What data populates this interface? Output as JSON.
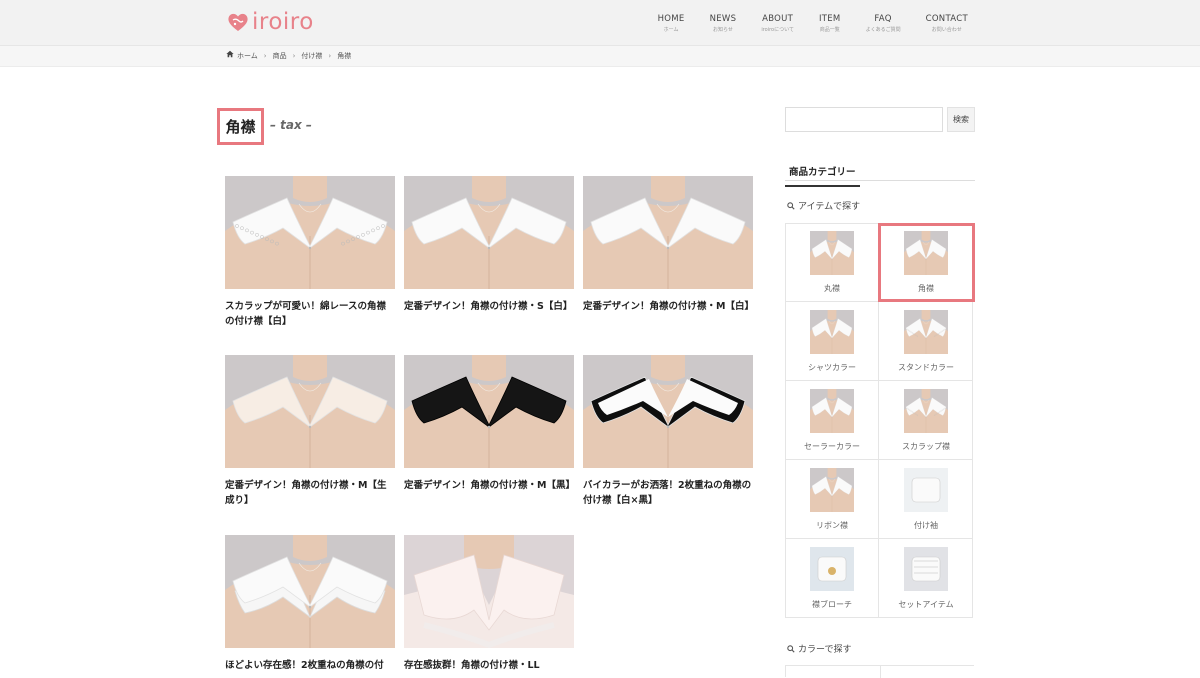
{
  "header": {
    "logo_text": "iroiro",
    "brand_color": "#e8828a",
    "nav": [
      {
        "label": "HOME",
        "sub": "ホーム"
      },
      {
        "label": "NEWS",
        "sub": "お知らせ"
      },
      {
        "label": "ABOUT",
        "sub": "iroiroについて"
      },
      {
        "label": "ITEM",
        "sub": "商品一覧"
      },
      {
        "label": "FAQ",
        "sub": "よくあるご質問"
      },
      {
        "label": "CONTACT",
        "sub": "お問い合わせ"
      }
    ]
  },
  "breadcrumb": {
    "items": [
      "ホーム",
      "商品",
      "付け襟",
      "角襟"
    ]
  },
  "page": {
    "title": "角襟",
    "subtitle": "– tax –"
  },
  "products": [
    {
      "name": "スカラップが可愛い！綿レースの角襟の付け襟【白】",
      "variant": "lace"
    },
    {
      "name": "定番デザイン！角襟の付け襟・S【白】",
      "variant": "white"
    },
    {
      "name": "定番デザイン！角襟の付け襟・M【白】",
      "variant": "white"
    },
    {
      "name": "定番デザイン！角襟の付け襟・M【生成り】",
      "variant": "ivory"
    },
    {
      "name": "定番デザイン！角襟の付け襟・M【黒】",
      "variant": "black"
    },
    {
      "name": "バイカラーがお洒落！2枚重ねの角襟の付け襟【白×黒】",
      "variant": "bicolor"
    },
    {
      "name": "ほどよい存在感！2枚重ねの角襟の付",
      "variant": "double"
    },
    {
      "name": "存在感抜群！角襟の付け襟・LL",
      "variant": "large"
    }
  ],
  "sidebar": {
    "search_placeholder": "",
    "search_button": "検索",
    "widget_title": "商品カテゴリー",
    "item_section": "アイテムで探す",
    "color_section": "カラーで探す",
    "categories": [
      {
        "label": "丸襟",
        "thumb": "round"
      },
      {
        "label": "角襟",
        "thumb": "square"
      },
      {
        "label": "シャツカラー",
        "thumb": "shirt"
      },
      {
        "label": "スタンドカラー",
        "thumb": "stand"
      },
      {
        "label": "セーラーカラー",
        "thumb": "sailor"
      },
      {
        "label": "スカラップ襟",
        "thumb": "scallop"
      },
      {
        "label": "リボン襟",
        "thumb": "ribbon"
      },
      {
        "label": "付け袖",
        "thumb": "sleeve"
      },
      {
        "label": "襟ブローチ",
        "thumb": "brooch"
      },
      {
        "label": "セットアイテム",
        "thumb": "set"
      }
    ],
    "selected_category": "角襟"
  },
  "colors": {
    "highlight": "#e8787f",
    "text": "#222222"
  }
}
